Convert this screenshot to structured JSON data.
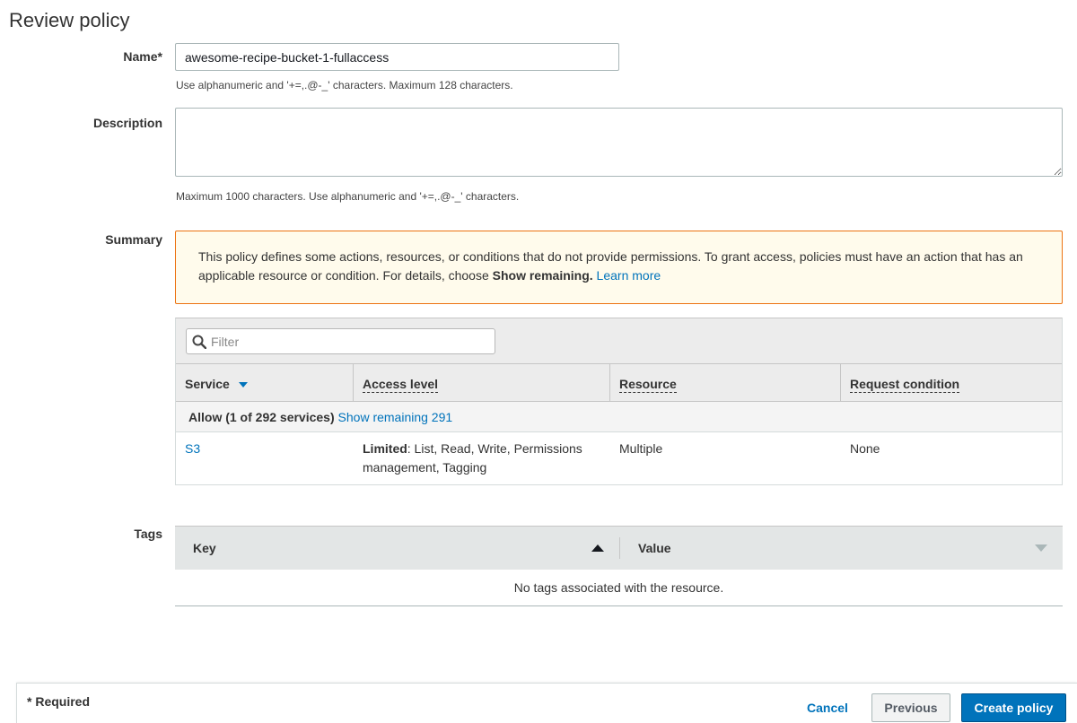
{
  "page": {
    "title": "Review policy"
  },
  "name_field": {
    "label": "Name*",
    "value": "awesome-recipe-bucket-1-fullaccess",
    "hint": "Use alphanumeric and '+=,.@-_' characters. Maximum 128 characters."
  },
  "description_field": {
    "label": "Description",
    "value": "",
    "hint": "Maximum 1000 characters. Use alphanumeric and '+=,.@-_' characters."
  },
  "summary": {
    "label": "Summary",
    "warning": {
      "text": "This policy defines some actions, resources, or conditions that do not provide permissions. To grant access, policies must have an action that has an applicable resource or condition. For details, choose ",
      "bold": "Show remaining.",
      "link": "Learn more"
    },
    "filter_placeholder": "Filter",
    "columns": [
      "Service",
      "Access level",
      "Resource",
      "Request condition"
    ],
    "group": {
      "label": "Allow (1 of 292 services)",
      "link": "Show remaining 291"
    },
    "rows": [
      {
        "service": "S3",
        "access_bold": "Limited",
        "access_rest": ": List, Read, Write, Permissions management, Tagging",
        "resource": "Multiple",
        "condition": "None"
      }
    ]
  },
  "tags": {
    "label": "Tags",
    "columns": [
      "Key",
      "Value"
    ],
    "empty_text": "No tags associated with the resource."
  },
  "footer": {
    "required_note": "* Required",
    "cancel": "Cancel",
    "previous": "Previous",
    "create": "Create policy"
  },
  "colors": {
    "accent": "#0073bb",
    "warning_border": "#ec7211",
    "warning_bg": "#fffbec"
  },
  "icons": {
    "filter": "search-icon",
    "service_sort": "caret-down-icon",
    "key_sort": "sort-ascending-icon",
    "value_sort": "sort-descending-icon"
  }
}
